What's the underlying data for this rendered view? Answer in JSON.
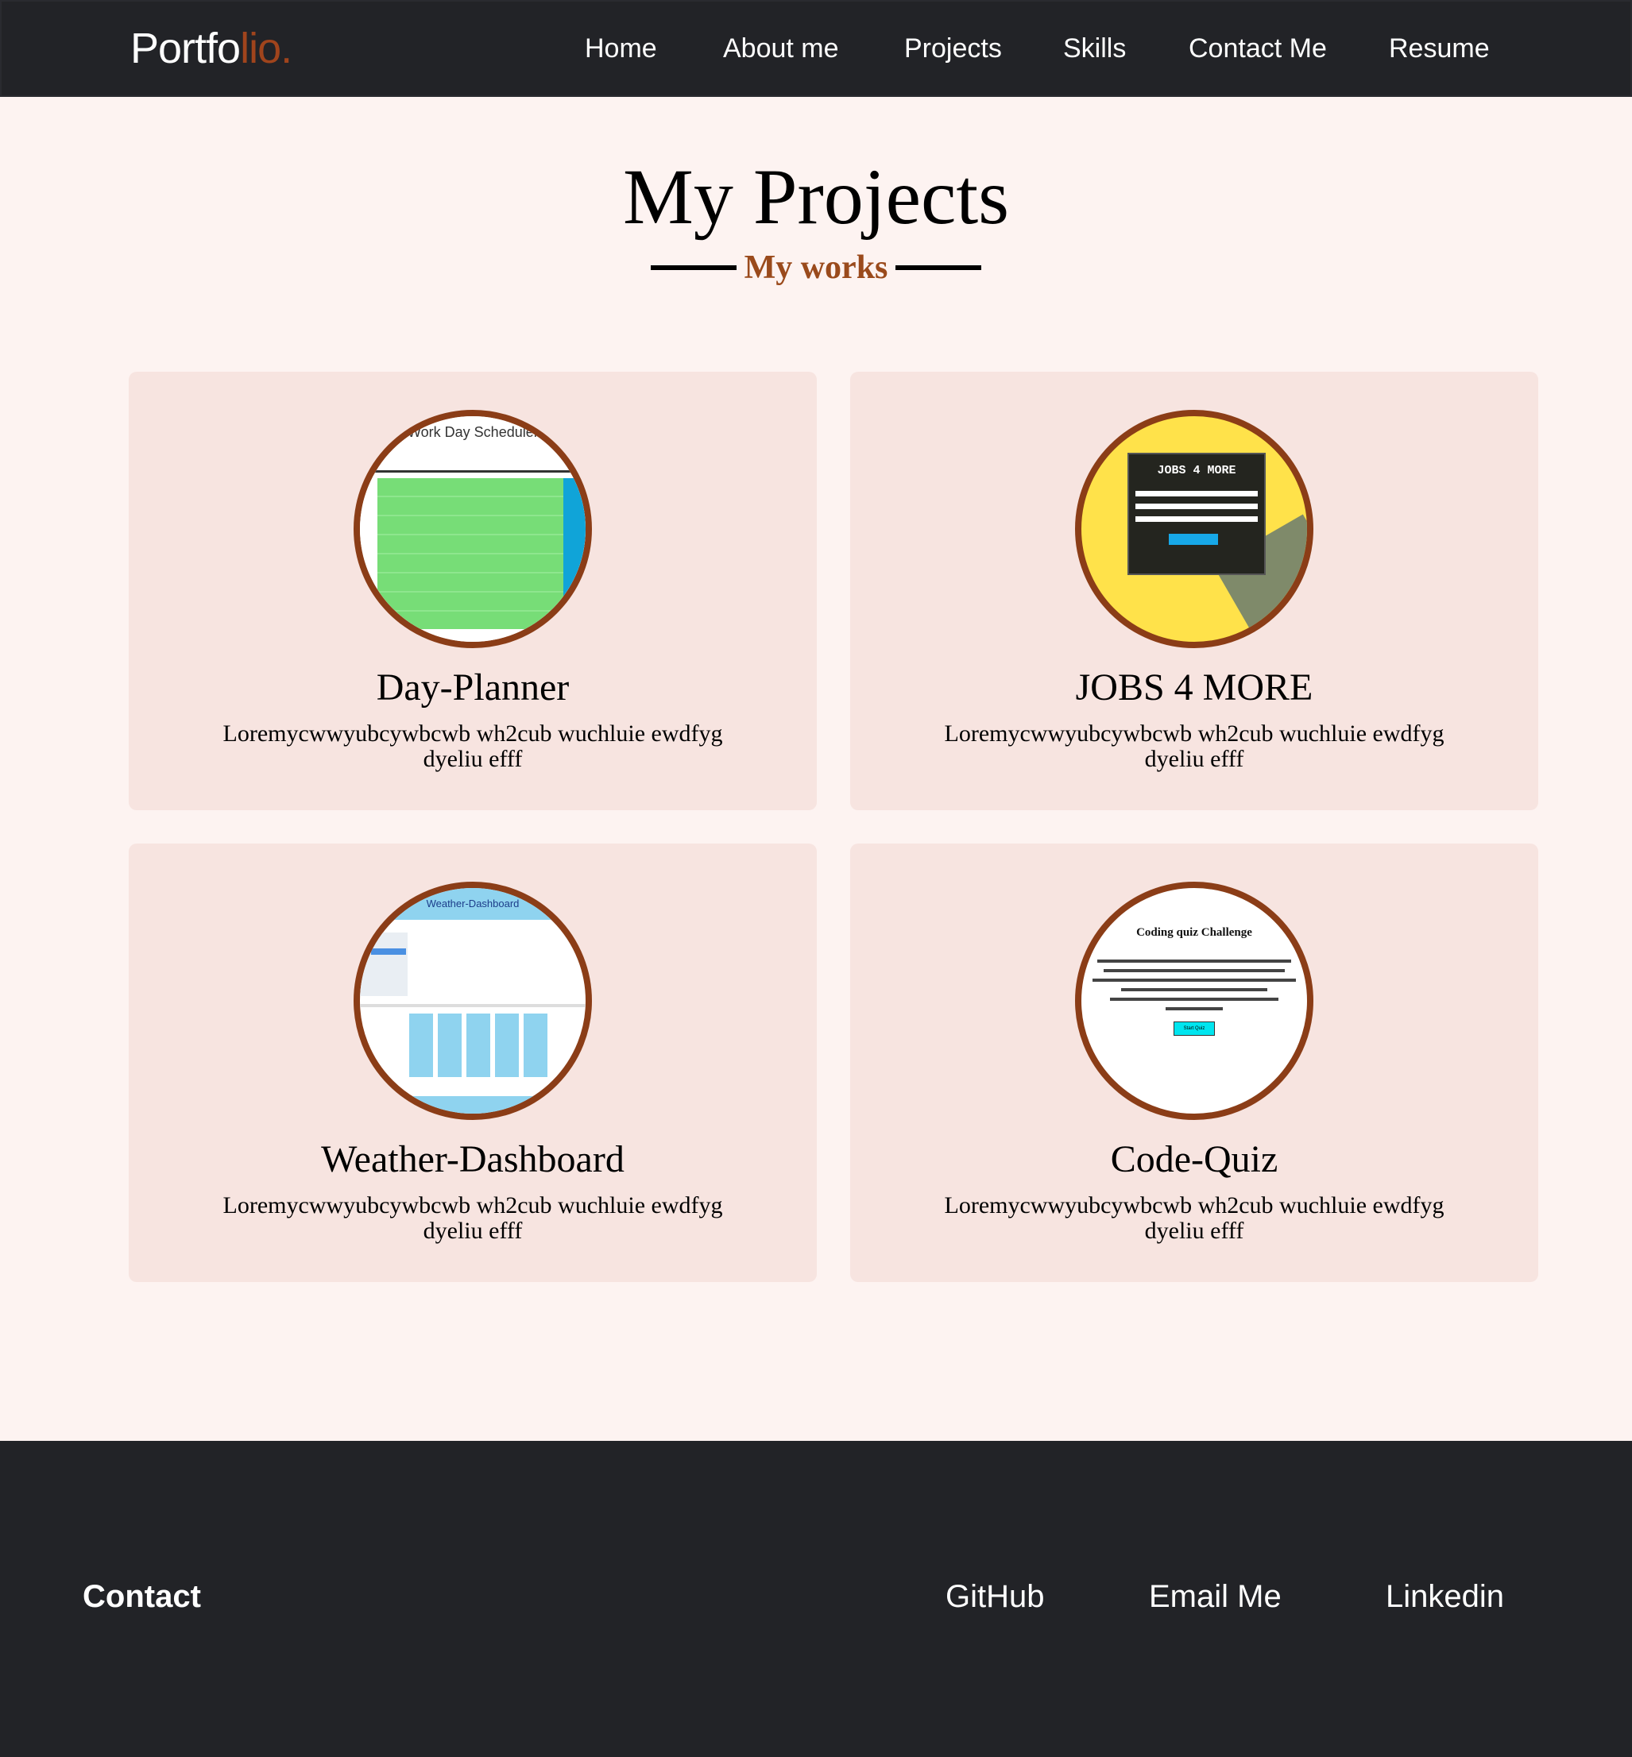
{
  "nav": {
    "logo_main": "Portfo",
    "logo_accent": "lio.",
    "links": [
      "Home",
      "About me",
      "Projects",
      "Skills",
      "Contact Me",
      "Resume"
    ]
  },
  "header": {
    "title": "My Projects",
    "subtitle": "My works"
  },
  "projects": [
    {
      "title": "Day-Planner",
      "description": "Loremycwwyubcywbcwb wh2cub wuchluie ewdfyg dyeliu efff",
      "thumb_text": "Work Day Scheduler"
    },
    {
      "title": "JOBS 4 MORE",
      "description": "Loremycwwyubcywbcwb wh2cub wuchluie ewdfyg dyeliu efff",
      "thumb_text": "JOBS 4 MORE"
    },
    {
      "title": "Weather-Dashboard",
      "description": "Loremycwwyubcywbcwb wh2cub wuchluie ewdfyg dyeliu efff",
      "thumb_text": "Weather-Dashboard"
    },
    {
      "title": "Code-Quiz",
      "description": "Loremycwwyubcywbcwb wh2cub wuchluie ewdfyg dyeliu efff",
      "thumb_text": "Coding quiz Challenge",
      "thumb_button": "Start Quiz"
    }
  ],
  "footer": {
    "title": "Contact",
    "links": [
      "GitHub",
      "Email Me",
      "Linkedin"
    ]
  },
  "colors": {
    "nav_bg": "#222327",
    "page_bg": "#fdf3f1",
    "card_bg": "#f7e4e0",
    "accent": "#a0441c",
    "thumb_border": "#8b3d17"
  }
}
